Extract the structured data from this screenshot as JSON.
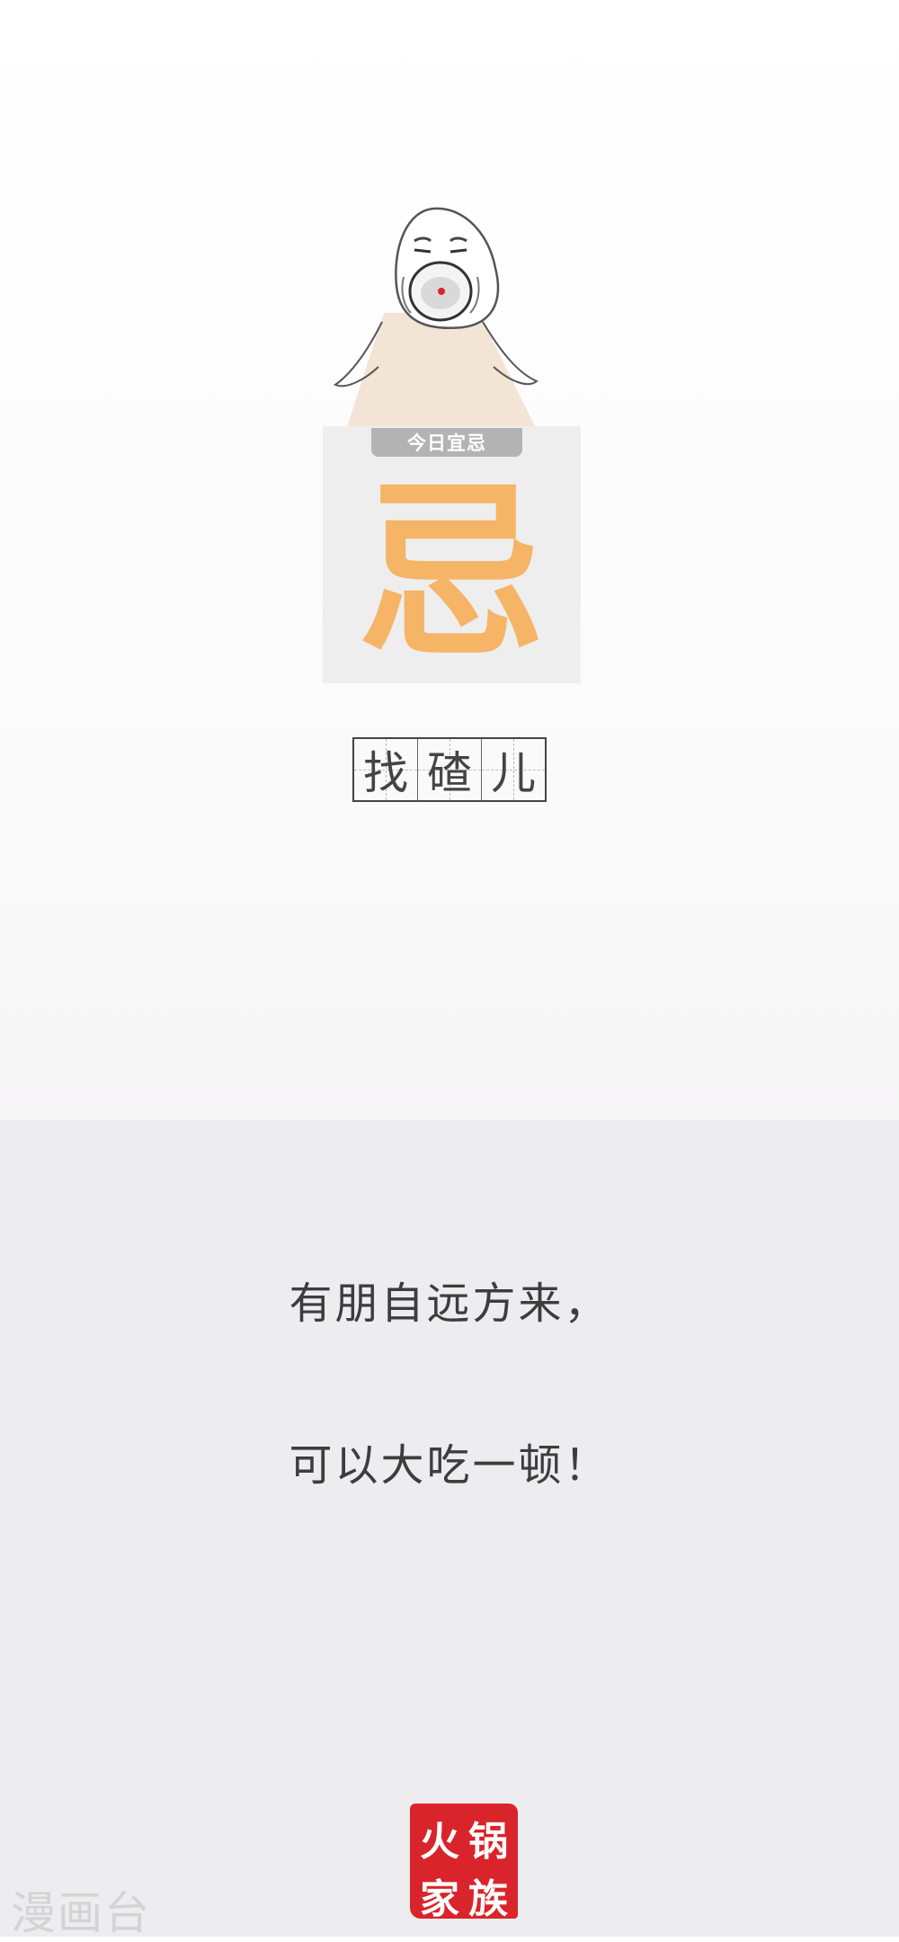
{
  "card": {
    "tab_label": "今日宜忌",
    "main_char": "忌"
  },
  "grid_chars": [
    "找",
    "碴",
    "儿"
  ],
  "messages": [
    "有朋自远方来，",
    "可以大吃一顿！"
  ],
  "seal": {
    "chars": [
      "锅",
      "火",
      "族",
      "家"
    ],
    "color": "#d9242b"
  },
  "watermark": "漫画台",
  "colors": {
    "accent": "#f6b466",
    "card_bg": "#eeeeee",
    "bottom_bg": "#edecee"
  }
}
